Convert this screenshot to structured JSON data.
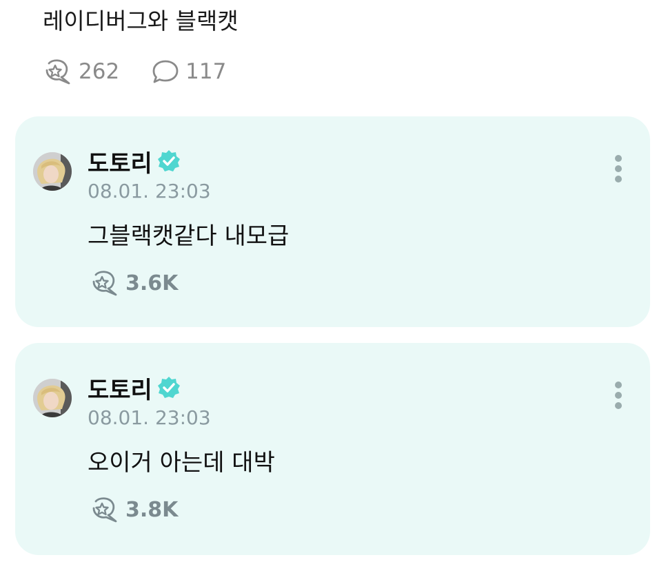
{
  "post": {
    "text": "레이디버그와 블랙캣",
    "stats": {
      "likes": "262",
      "comments": "117"
    }
  },
  "comments": [
    {
      "author": "도토리",
      "verified": true,
      "time": "08.01. 23:03",
      "text": "그블랙캣같다 내모급",
      "likes": "3.6K"
    },
    {
      "author": "도토리",
      "verified": true,
      "time": "08.01. 23:03",
      "text": "오이거 아는데 대박",
      "likes": "3.8K"
    }
  ],
  "colors": {
    "card_background": "#eaf9f7",
    "verified_badge": "#4fd6d0",
    "timestamp": "#8a9aa0",
    "count_gray": "#8a8a8a"
  },
  "icons": {
    "like": "cheer-bubble-star-icon",
    "comment": "speech-bubble-icon",
    "verified": "verified-badge-icon",
    "more": "more-vertical-icon"
  }
}
